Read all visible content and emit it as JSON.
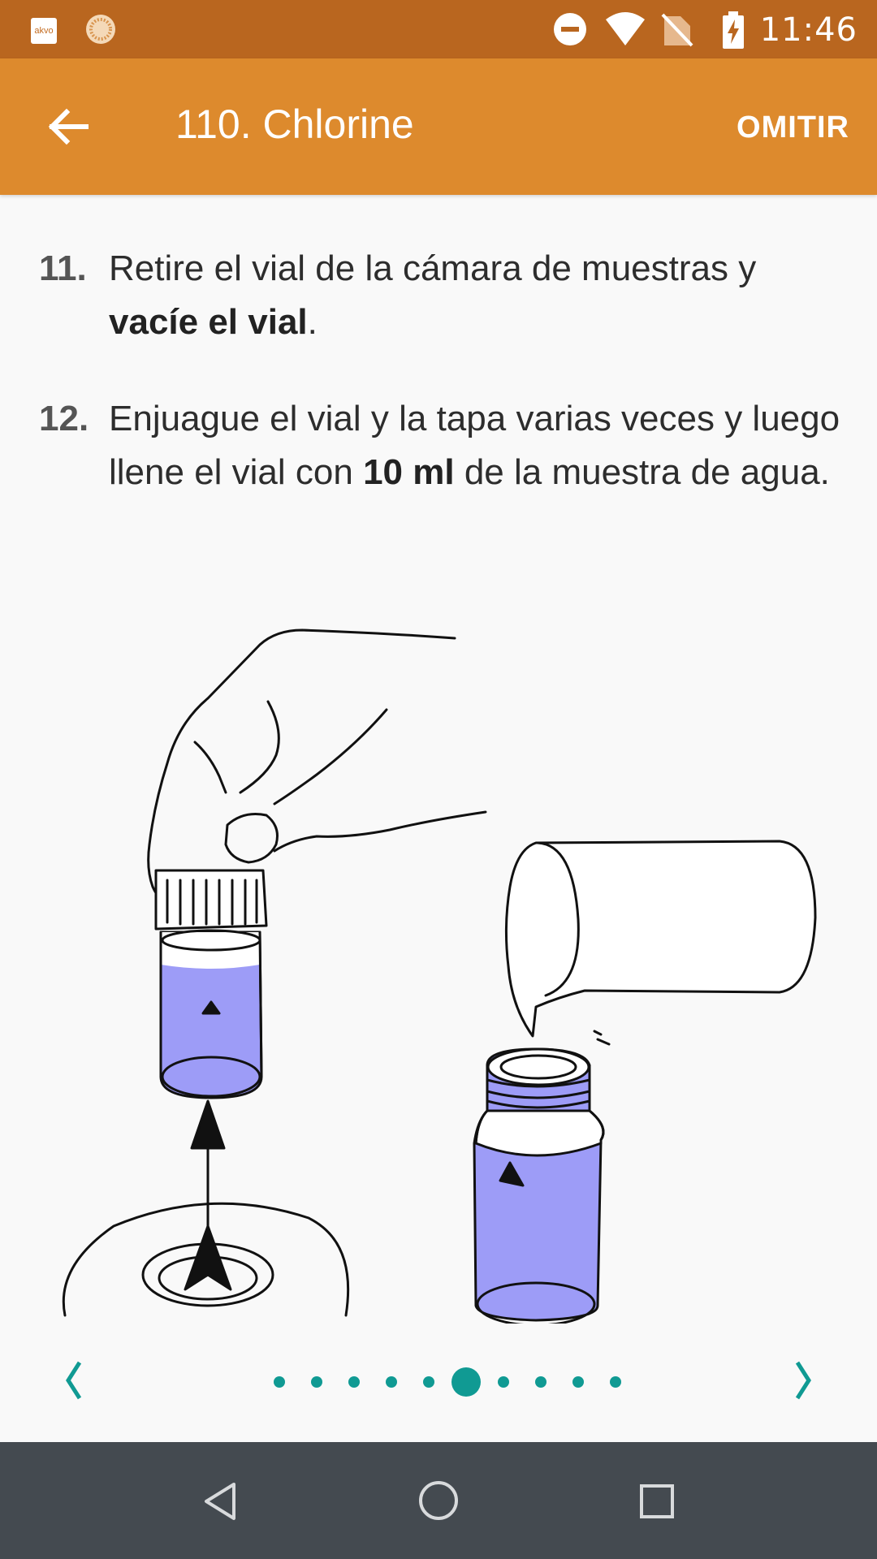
{
  "status_bar": {
    "time": "11:46",
    "app_icon_label": "akvo",
    "icons": [
      "akvo-app-icon",
      "caddisfly-app-icon",
      "do-not-disturb-icon",
      "wifi-icon",
      "no-sim-icon",
      "battery-charging-icon"
    ]
  },
  "app_bar": {
    "title": "110. Chlorine",
    "skip_label": "OMITIR",
    "back_icon": "arrow-left-icon"
  },
  "steps": [
    {
      "number": "11.",
      "text_parts": [
        "Retire el vial de la cámara de muestras y ",
        "vacíe el vial",
        "."
      ]
    },
    {
      "number": "12.",
      "text_parts": [
        "Enjuague el vial y la tapa varias veces y luego llene el vial con ",
        "10 ml",
        " de la muestra de agua."
      ]
    }
  ],
  "pager": {
    "prev_icon": "chevron-left-icon",
    "next_icon": "chevron-right-icon",
    "total_pages": 10,
    "current_page": 6,
    "accent_color": "#109a93"
  },
  "nav_bar": {
    "icons": [
      "back-triangle-icon",
      "home-circle-icon",
      "recents-square-icon"
    ]
  },
  "colors": {
    "status_bar": "#b9661f",
    "app_bar": "#dd8a2d",
    "liquid": "#9d9cf7",
    "nav_bar": "#444a50"
  }
}
